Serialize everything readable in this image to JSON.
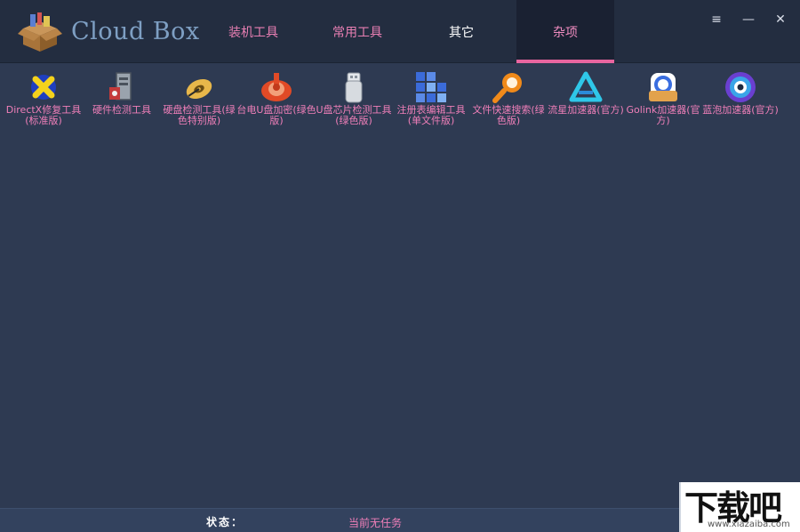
{
  "app": {
    "title": "Cloud Box"
  },
  "tabs": [
    {
      "label": "装机工具"
    },
    {
      "label": "常用工具"
    },
    {
      "label": "其它"
    },
    {
      "label": "杂项"
    }
  ],
  "window_controls": {
    "menu": "≡",
    "minimize": "—",
    "close": "✕"
  },
  "tools": [
    {
      "label": "DirectX修复工具(标准版)",
      "icon": "directx-repair-icon"
    },
    {
      "label": "硬件检测工具",
      "icon": "hardware-detect-icon"
    },
    {
      "label": "硬盘检测工具(绿色特别版)",
      "icon": "disk-detect-icon"
    },
    {
      "label": "台电U盘加密(绿色版)",
      "icon": "usb-encrypt-icon"
    },
    {
      "label": "U盘芯片检测工具(绿色版)",
      "icon": "usb-chip-icon"
    },
    {
      "label": "注册表编辑工具(单文件版)",
      "icon": "registry-editor-icon"
    },
    {
      "label": "文件快速搜索(绿色版)",
      "icon": "file-search-icon"
    },
    {
      "label": "流星加速器(官方)",
      "icon": "meteor-accelerator-icon"
    },
    {
      "label": "Golink加速器(官方)",
      "icon": "golink-accelerator-icon"
    },
    {
      "label": "蓝泡加速器(官方)",
      "icon": "bluebubble-accelerator-icon"
    }
  ],
  "status": {
    "label": "状态：",
    "value": "当前无任务"
  },
  "watermark": {
    "text": "下载吧",
    "url": "www.xiazaiba.com"
  },
  "colors": {
    "accent": "#e8659f",
    "background": "#2e3a52",
    "header": "#232d40"
  }
}
